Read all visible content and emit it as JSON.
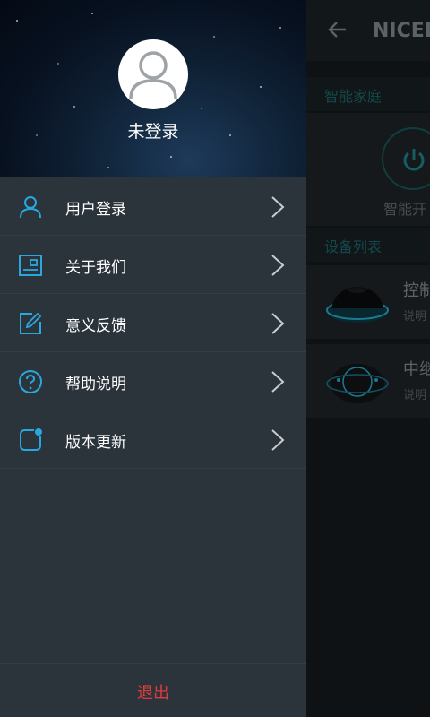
{
  "background_app": {
    "title": "NICEL",
    "section_smart_home": "智能家庭",
    "smart_switch_label": "智能开",
    "section_device_list": "设备列表",
    "devices": [
      {
        "name": "控制",
        "desc": "说明"
      },
      {
        "name": "中继",
        "desc": "说明"
      }
    ]
  },
  "drawer": {
    "login_state": "未登录",
    "menu_items": [
      {
        "label": "用户登录",
        "icon": "user-icon"
      },
      {
        "label": "关于我们",
        "icon": "about-card-icon"
      },
      {
        "label": "意义反馈",
        "icon": "edit-feedback-icon"
      },
      {
        "label": "帮助说明",
        "icon": "help-question-icon"
      },
      {
        "label": "版本更新",
        "icon": "update-dot-icon"
      }
    ],
    "logout_label": "退出"
  },
  "colors": {
    "accent": "#29a8e0",
    "logout": "#e03c3c",
    "drawer_bg": "#2b333b"
  }
}
